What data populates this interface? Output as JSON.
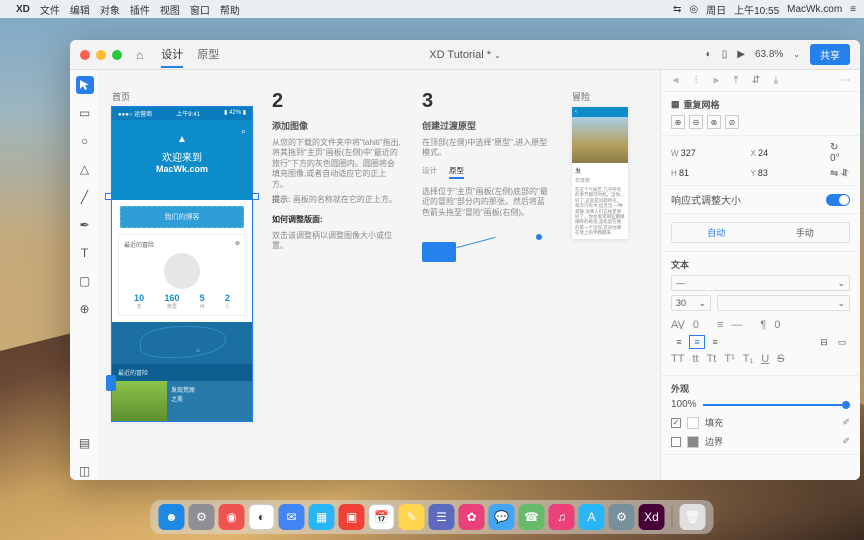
{
  "menubar": {
    "app": "XD",
    "items": [
      "文件",
      "编辑",
      "对象",
      "插件",
      "视图",
      "窗口",
      "帮助"
    ],
    "right": {
      "day": "周日",
      "time": "上午10:55",
      "site": "MacWk.com"
    }
  },
  "window": {
    "tabs": {
      "design": "设计",
      "prototype": "原型"
    },
    "title": "XD Tutorial * ",
    "zoom": "63.8%",
    "share": "共享"
  },
  "artboards": {
    "a1_label": "首页",
    "a2_label": "冒险",
    "hero": {
      "welcome": "欢迎来到",
      "domain": "MacWk.com",
      "button": "我们的博客",
      "time": "上午9:41",
      "carrier": "●●●○ 运营商"
    },
    "card": {
      "title": "最近的冒险",
      "stats": [
        {
          "n": "10",
          "l": "天"
        },
        {
          "n": "160",
          "l": "英里"
        },
        {
          "n": "5",
          "l": "州"
        },
        {
          "n": "2",
          "l": "人"
        }
      ]
    },
    "recent": {
      "label": "最近的冒险",
      "card_title": "发现荒原",
      "card_sub": "之美"
    }
  },
  "instruction2": {
    "num": "2",
    "title": "添加图像",
    "p1": "从您的下载的文件夹中将\"tahiti\"拖出,将其拖到\"主页\"画板(左侧)中\"最近的旅行\"下方的灰色圆圈内。圆圈将会填充图像,或者自动适应它的正上方。",
    "tip_label": "提示:",
    "tip": "画板的名称就在它的正上方。",
    "resize_title": "如何调整版面:",
    "resize": "双击该调整柄以调整图像大小或位置。"
  },
  "instruction3": {
    "num": "3",
    "title": "创建过渡原型",
    "p1": "在顶部(左侧)中选择\"原型\",进入原型模式。",
    "seg1": "设计",
    "seg2": "原型",
    "p2": "选择位于\"主页\"画板(左侧)底部的\"最近的冒险\"部分内的那张。然后将蓝色箭头拖至\"冒险\"画板(右侧)。"
  },
  "art2": {
    "title": "发",
    "meta": "年度旅",
    "body": "在这个气候区,几乎所有的季节都可时机。当你...好了,这就是问题所在。每次只有木,但灵活,一种寂静,仿佛人们已经足够好了。你会发现那些震撼眼眸的奇观,蓝松鼠在她的第一个出现,其间仿佛在地上的半颗醒来"
  },
  "inspector": {
    "repeat_grid": "重复网格",
    "w": "327",
    "x": "24",
    "h": "81",
    "y": "83",
    "rot": "0",
    "responsive": "响应式调整大小",
    "auto": "自动",
    "manual": "手动",
    "text_section": "文本",
    "font_size": "30",
    "appearance": "外观",
    "opacity": "100%",
    "fill": "填充",
    "border": "边界"
  },
  "dock": {
    "apps": [
      {
        "c": "#1e88e5",
        "g": "☻"
      },
      {
        "c": "#8e8e93",
        "g": "⚙"
      },
      {
        "c": "#ef5350",
        "g": "◉"
      },
      {
        "c": "#ffffff",
        "g": "◐"
      },
      {
        "c": "#4285f4",
        "g": "✉"
      },
      {
        "c": "#29b6f6",
        "g": "▦"
      },
      {
        "c": "#ef4136",
        "g": "▣"
      },
      {
        "c": "#fff",
        "g": "📅"
      },
      {
        "c": "#ffd54f",
        "g": "✎"
      },
      {
        "c": "#5c6bc0",
        "g": "☰"
      },
      {
        "c": "#ec407a",
        "g": "✿"
      },
      {
        "c": "#42a5f5",
        "g": "💬"
      },
      {
        "c": "#66bb6a",
        "g": "☎"
      },
      {
        "c": "#ec407a",
        "g": "♫"
      },
      {
        "c": "#29b6f6",
        "g": "A"
      },
      {
        "c": "#78909c",
        "g": "⚙"
      },
      {
        "c": "#470137",
        "g": "Xd"
      },
      {
        "c": "#e0e0e0",
        "g": "🗑"
      }
    ]
  }
}
